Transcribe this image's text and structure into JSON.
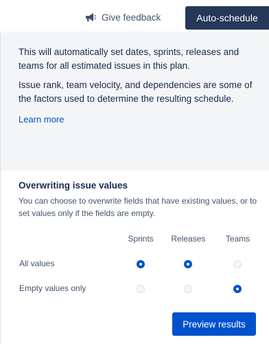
{
  "header": {
    "feedback_label": "Give feedback",
    "feedback_icon": "megaphone-icon",
    "auto_schedule_label": "Auto-schedule"
  },
  "info": {
    "paragraph1": "This will automatically set dates, sprints, releases and teams for all estimated issues in this plan.",
    "paragraph2": "Issue rank, team velocity, and dependencies are some of the factors used to determine the resulting schedule.",
    "learn_more": "Learn more"
  },
  "overwrite": {
    "title": "Overwriting issue values",
    "description": "You can choose to overwrite fields that have existing values, or to set values only if the fields are empty.",
    "columns": [
      "Sprints",
      "Releases",
      "Teams"
    ],
    "rows": [
      {
        "label": "All values",
        "selected": [
          true,
          true,
          false
        ]
      },
      {
        "label": "Empty values only",
        "selected": [
          false,
          false,
          true
        ]
      }
    ]
  },
  "footer": {
    "preview_label": "Preview results"
  },
  "colors": {
    "primary": "#0052cc",
    "dark_button": "#253858",
    "info_bg": "#f4f5f7"
  }
}
